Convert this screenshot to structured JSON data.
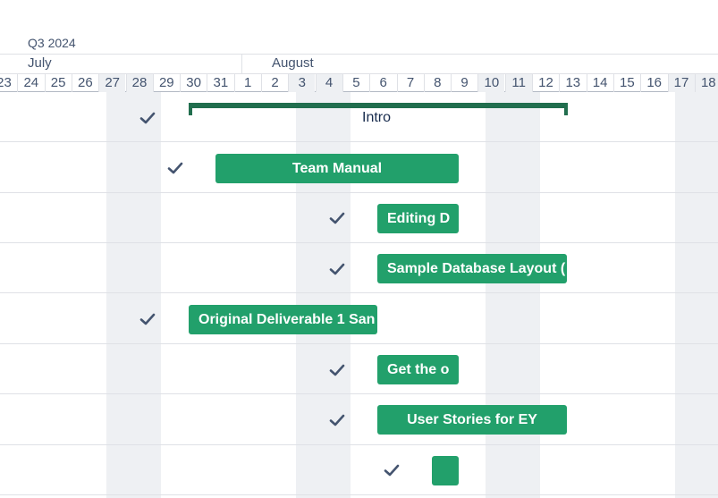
{
  "timeline": {
    "quarter": "Q3 2024",
    "months": [
      "July",
      "August"
    ],
    "days": [
      "23",
      "24",
      "25",
      "26",
      "27",
      "28",
      "29",
      "30",
      "31",
      "1",
      "2",
      "3",
      "4",
      "5",
      "6",
      "7",
      "8",
      "9",
      "10",
      "11",
      "12",
      "13",
      "14",
      "15",
      "16",
      "17",
      "18"
    ],
    "weekend_days": [
      "27",
      "28",
      "3",
      "4",
      "10",
      "11",
      "17",
      "18"
    ]
  },
  "epic": {
    "label": "Intro"
  },
  "items": [
    {
      "label": "Team Manual",
      "status": "done"
    },
    {
      "label": "Editing D",
      "status": "done"
    },
    {
      "label": "Sample Database Layout (",
      "status": "done"
    },
    {
      "label": "Original Deliverable 1 San",
      "status": "done"
    },
    {
      "label": "Get the o",
      "status": "done"
    },
    {
      "label": "User Stories for EY",
      "status": "done"
    },
    {
      "label": "",
      "status": "done"
    }
  ],
  "colors": {
    "bar": "#22a06b",
    "epic": "#216e4e",
    "check": "#44546f",
    "weekend": "#eef0f3"
  },
  "icons": {
    "done": "checkmark-icon"
  }
}
